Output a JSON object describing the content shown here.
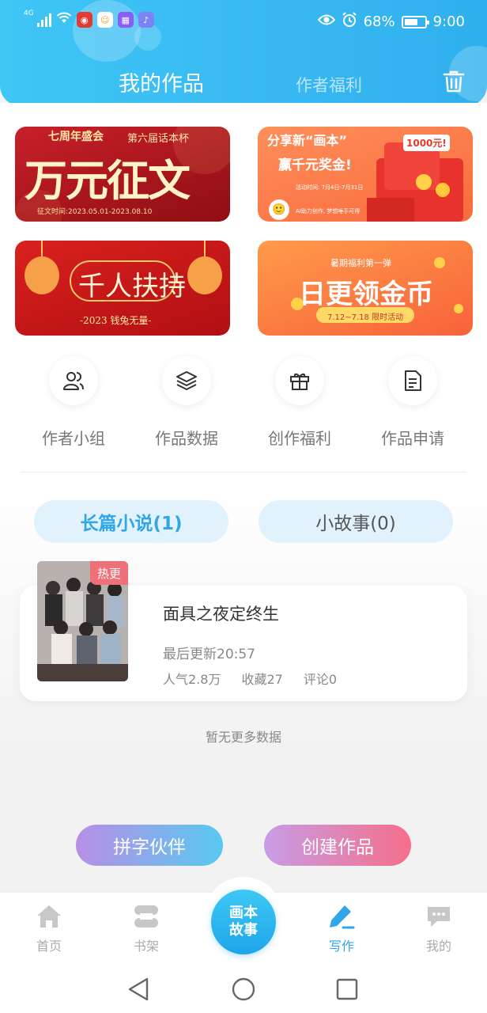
{
  "status_bar": {
    "network": "4G",
    "battery_percent": "68%",
    "battery_level": 0.68,
    "time": "9:00"
  },
  "header": {
    "tab_active": "我的作品",
    "tab_inactive": "作者福利",
    "trash_icon": "trash-icon"
  },
  "banners": [
    {
      "top_text": "七周年盛会",
      "side_text": "第六届话本杯",
      "main_text": "万元征文",
      "date_text": "征文时间:2023.05.01-2023.08.10"
    },
    {
      "top_text": "分享新“画本”",
      "main_text": "赢千元奖金!",
      "badge_text": "1000元!",
      "date_text": "活动时间: 7月4日-7月31日",
      "sub_text": "AI助力创作, 梦想唾手可得"
    },
    {
      "main_text": "千人扶持",
      "sub_text": "-2023 钱兔无量-"
    },
    {
      "top_text": "暑期福利第一弹",
      "main_text": "日更领金币",
      "sub_text": "7.12~7.18 限时活动"
    }
  ],
  "quick_actions": [
    {
      "label": "作者小组",
      "icon": "group-icon"
    },
    {
      "label": "作品数据",
      "icon": "layers-icon"
    },
    {
      "label": "创作福利",
      "icon": "gift-icon"
    },
    {
      "label": "作品申请",
      "icon": "document-icon"
    }
  ],
  "segments": {
    "novel": "长篇小说(1)",
    "story": "小故事(0)"
  },
  "work": {
    "tag": "热更",
    "title": "面具之夜定终生",
    "update": "最后更新20:57",
    "popularity": "人气2.8万",
    "favorites": "收藏27",
    "comments": "评论0"
  },
  "no_more_text": "暂无更多数据",
  "actions": {
    "partner": "拼字伙伴",
    "create": "创建作品"
  },
  "bottom_nav": {
    "home": "首页",
    "shelf": "书架",
    "center_line1": "画本",
    "center_line2": "故事",
    "write": "写作",
    "mine": "我的"
  },
  "colors": {
    "accent": "#2fa6e7",
    "header": "#38b8f2",
    "hot_tag": "#f0707a"
  }
}
